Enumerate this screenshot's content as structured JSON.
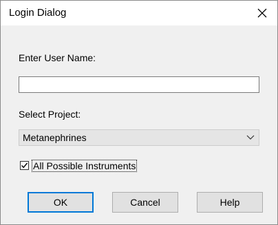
{
  "window": {
    "title": "Login Dialog"
  },
  "form": {
    "username_label": "Enter User Name:",
    "username_value": "",
    "project_label": "Select Project:",
    "project_selected": "Metanephrines",
    "instruments_label": "All Possible Instruments",
    "instruments_checked": true
  },
  "buttons": {
    "ok": "OK",
    "cancel": "Cancel",
    "help": "Help"
  },
  "icons": {
    "close": "close-icon",
    "dropdown": "chevron-down-icon",
    "check": "checkmark-icon"
  },
  "colors": {
    "accent": "#0078d7",
    "dialog_bg": "#f0f0f0",
    "button_bg": "#e1e1e1"
  }
}
